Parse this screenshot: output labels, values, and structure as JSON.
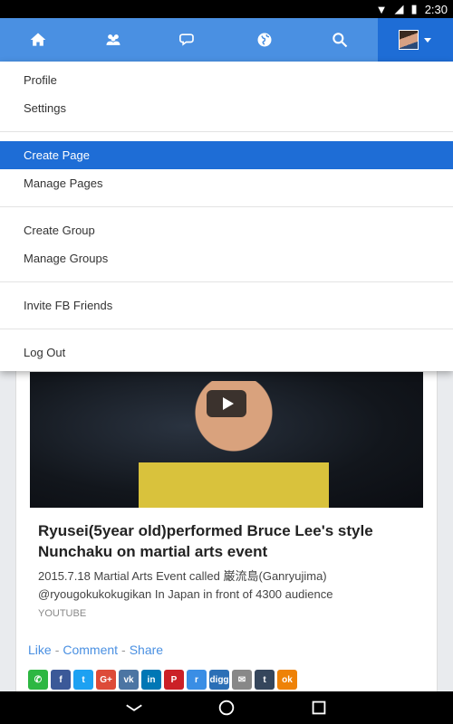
{
  "status_bar": {
    "time": "2:30",
    "icons": [
      "wifi-icon",
      "signal-icon",
      "battery-icon"
    ]
  },
  "nav": {
    "items": [
      "home-icon",
      "friends-icon",
      "chat-icon",
      "globe-icon",
      "search-icon",
      "avatar"
    ],
    "active": "avatar"
  },
  "menu": {
    "group1": [
      "Profile",
      "Settings"
    ],
    "group2": [
      "Create Page",
      "Manage Pages"
    ],
    "group3": [
      "Create Group",
      "Manage Groups"
    ],
    "group4": [
      "Invite FB Friends"
    ],
    "group5": [
      "Log Out"
    ],
    "selected": "Create Page"
  },
  "post": {
    "title": "Ryusei(5year old)performed Bruce Lee's style Nunchaku on martial arts event",
    "description": "2015.7.18 Martial Arts Event called 巌流島(Ganryujima) @ryougokukokugikan In Japan in front of 4300 audience",
    "source": "YOUTUBE"
  },
  "actions": {
    "like": "Like",
    "comment": "Comment",
    "share": "Share",
    "separator": "-"
  },
  "share_icons": [
    {
      "name": "whatsapp-icon",
      "glyph": "✆",
      "color": "#2db742"
    },
    {
      "name": "facebook-icon",
      "glyph": "f",
      "color": "#3b5998"
    },
    {
      "name": "twitter-icon",
      "glyph": "t",
      "color": "#1da1f2"
    },
    {
      "name": "googleplus-icon",
      "glyph": "G+",
      "color": "#dd4b39"
    },
    {
      "name": "vk-icon",
      "glyph": "vk",
      "color": "#4c75a3"
    },
    {
      "name": "linkedin-icon",
      "glyph": "in",
      "color": "#0077b5"
    },
    {
      "name": "pinterest-icon",
      "glyph": "P",
      "color": "#cb2027"
    },
    {
      "name": "reddit-icon",
      "glyph": "r",
      "color": "#3a8ee5"
    },
    {
      "name": "digg-icon",
      "glyph": "digg",
      "color": "#2b6fb6"
    },
    {
      "name": "email-icon",
      "glyph": "✉",
      "color": "#888"
    },
    {
      "name": "tumblr-icon",
      "glyph": "t",
      "color": "#35465c"
    },
    {
      "name": "odnoklassniki-icon",
      "glyph": "ok",
      "color": "#ee8208"
    }
  ],
  "colors": {
    "nav_bg": "#4a90e2",
    "selected_bg": "#1e6dd6",
    "link": "#4a90e2"
  }
}
